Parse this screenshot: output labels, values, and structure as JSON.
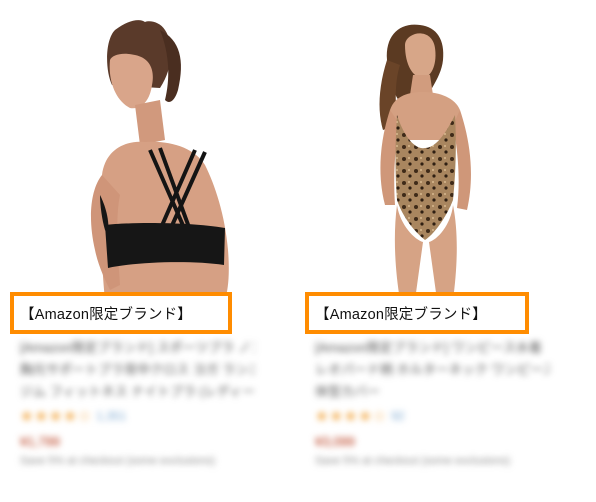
{
  "products": [
    {
      "badge": "【Amazon限定ブランド】",
      "image_alt": "black sports bra, back view",
      "title_lines": [
        "[Amazon限定ブランド] スポーツブラ ノンワイヤー",
        "胸元サポートブラ背中クロス ヨガ ランニング",
        "ジム フィットネス ナイトブラ (レディース)"
      ],
      "stars": "★★★★☆",
      "review_count": "1,351",
      "price": "¥1,799",
      "shipping": "Save 5% at checkout (some exclusions)"
    },
    {
      "badge": "【Amazon限定ブランド】",
      "image_alt": "leopard print one-piece swimsuit",
      "title_lines": [
        "[Amazon限定ブランド] ワンピース水着",
        "レオパード柄 ホルターネック ワンピース水着",
        "体型カバー"
      ],
      "stars": "★★★★☆",
      "review_count": "92",
      "price": "¥3,099",
      "shipping": "Save 5% at checkout (some exclusions)"
    }
  ],
  "colors": {
    "badge_border": "#ff8c00",
    "price": "#b12704",
    "stars": "#f1a33a"
  }
}
